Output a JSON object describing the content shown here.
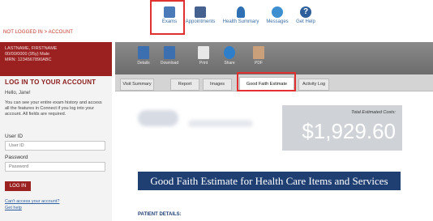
{
  "header": {
    "not_logged_in": "NOT LOGGED IN > ACCOUNT",
    "nav": [
      {
        "label": "Exams",
        "icon": "exams-icon"
      },
      {
        "label": "Appointments",
        "icon": "calendar-icon"
      },
      {
        "label": "Health Summary",
        "icon": "person-icon"
      },
      {
        "label": "Messages",
        "icon": "chat-icon"
      },
      {
        "label": "Get Help",
        "icon": "help-icon"
      }
    ],
    "help_glyph": "?"
  },
  "sidebar": {
    "patient_name": "LASTNAME, FIRSTNAME",
    "patient_info": "00/00/0000 (95y) Male",
    "mrn": "MRN: 1234567890ABC",
    "login_title": "LOG IN TO YOUR ACCOUNT",
    "hello": "Hello, Jane!",
    "intro": "You can see your entire exam history and access all the features in Connect if you log into your account. All fields are required.",
    "userid_label": "User ID",
    "userid_placeholder": "User ID",
    "password_label": "Password",
    "password_placeholder": "Password",
    "login_button": "LOG IN",
    "cant_access": "Can't access your account?",
    "get_help": "Get help"
  },
  "toolbar": {
    "details": "Details",
    "download": "Download",
    "print": "Print",
    "share": "Share",
    "pdf": "PDF"
  },
  "tabs": [
    "Visit Summary",
    "Report",
    "Images",
    "Good Faith Estimate",
    "Activity Log"
  ],
  "estimate": {
    "cost_label": "Total Estimated Costs:",
    "cost_amount": "$1,929.60",
    "banner": "Good Faith Estimate for Health Care Items and Services",
    "patient_details": "PATIENT DETAILS:"
  },
  "colors": {
    "accent_red": "#9b2020",
    "banner_blue": "#1f3f73",
    "highlight": "#e03030",
    "link_blue": "#2d5fa0"
  }
}
